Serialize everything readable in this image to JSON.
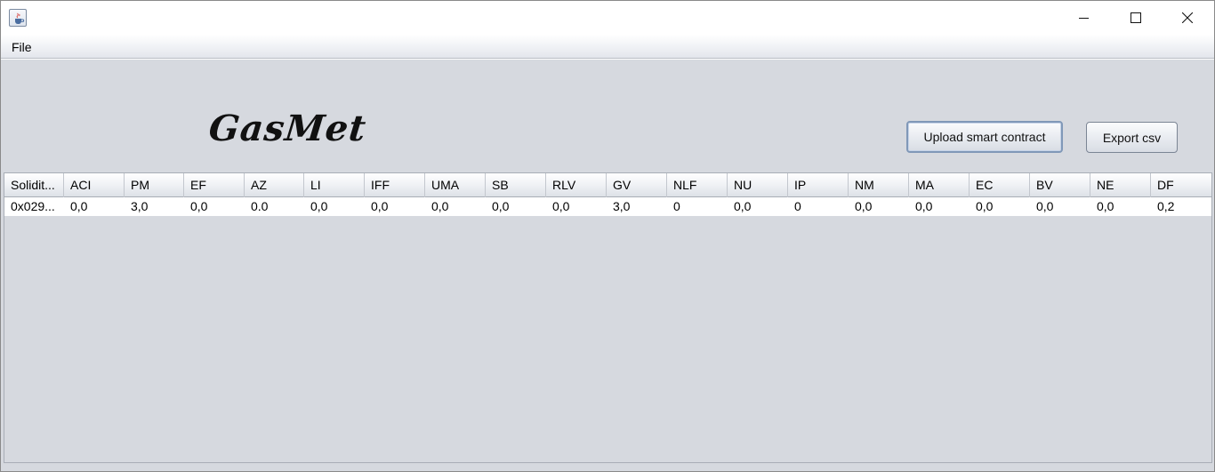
{
  "window": {
    "icons": {
      "app": "java-cup-icon",
      "minimize": "minimize-icon",
      "maximize": "maximize-icon",
      "close": "close-icon"
    }
  },
  "menubar": {
    "file_label": "File"
  },
  "main": {
    "logo_text": "GasMet",
    "upload_label": "Upload smart contract",
    "export_label": "Export csv"
  },
  "table": {
    "columns": [
      "Solidit...",
      "ACI",
      "PM",
      "EF",
      "AZ",
      "LI",
      "IFF",
      "UMA",
      "SB",
      "RLV",
      "GV",
      "NLF",
      "NU",
      "IP",
      "NM",
      "MA",
      "EC",
      "BV",
      "NE",
      "DF"
    ],
    "rows": [
      [
        "0x029...",
        "0,0",
        "3,0",
        "0,0",
        "0.0",
        "0,0",
        "0,0",
        "0,0",
        "0,0",
        "0,0",
        "3,0",
        "0",
        "0,0",
        "0",
        "0,0",
        "0,0",
        "0,0",
        "0,0",
        "0,0",
        "0,2"
      ]
    ]
  }
}
